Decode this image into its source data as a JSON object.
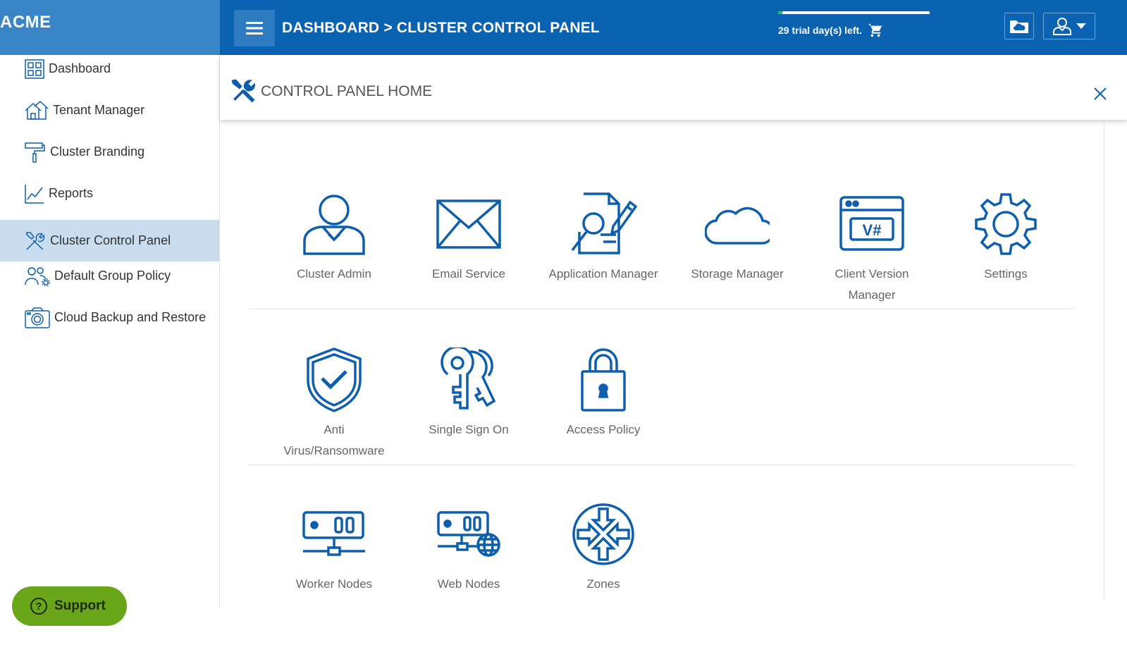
{
  "brand": {
    "name": "ACME"
  },
  "header": {
    "breadcrumb": "DASHBOARD > CLUSTER CONTROL PANEL",
    "trial_text": "29 trial day(s) left.",
    "trial_progress_fraction": 0.03,
    "icons": {
      "menu": "hamburger-icon",
      "cart": "cart-icon",
      "cloud": "cloud-folder-icon",
      "user": "user-icon"
    }
  },
  "sidebar": {
    "items": [
      {
        "label": "Dashboard",
        "icon": "dashboard-grid-icon",
        "active": false
      },
      {
        "label": "Tenant Manager",
        "icon": "tenant-houses-icon",
        "active": false
      },
      {
        "label": "Cluster Branding",
        "icon": "paint-roller-icon",
        "active": false
      },
      {
        "label": "Reports",
        "icon": "line-chart-icon",
        "active": false
      },
      {
        "label": "Cluster Control Panel",
        "icon": "tools-icon",
        "active": true
      },
      {
        "label": "Default Group Policy",
        "icon": "group-gear-icon",
        "active": false
      },
      {
        "label": "Cloud Backup and Restore",
        "icon": "camera-icon",
        "active": false
      }
    ]
  },
  "panel": {
    "title": "CONTROL PANEL HOME",
    "rows": [
      [
        {
          "label": "Cluster Admin",
          "icon": "admin-user-icon"
        },
        {
          "label": "Email Service",
          "icon": "envelope-icon"
        },
        {
          "label": "Application Manager",
          "icon": "application-search-icon"
        },
        {
          "label": "Storage Manager",
          "icon": "cloud-icon"
        },
        {
          "label": "Client Version Manager",
          "icon": "browser-code-icon"
        },
        {
          "label": "Settings",
          "icon": "gear-icon"
        }
      ],
      [
        {
          "label": "Anti Virus/Ransomware",
          "icon": "shield-check-icon"
        },
        {
          "label": "Single Sign On",
          "icon": "keys-icon"
        },
        {
          "label": "Access Policy",
          "icon": "padlock-icon"
        }
      ],
      [
        {
          "label": "Worker Nodes",
          "icon": "server-node-icon"
        },
        {
          "label": "Web Nodes",
          "icon": "server-globe-icon"
        },
        {
          "label": "Zones",
          "icon": "router-arrows-icon"
        }
      ]
    ]
  },
  "support": {
    "label": "Support"
  },
  "colors": {
    "header": "#0b62b0",
    "brand": "#3a85c6",
    "accent": "#0d5fae",
    "active_item": "#c9ddef",
    "support": "#6aa61a"
  }
}
